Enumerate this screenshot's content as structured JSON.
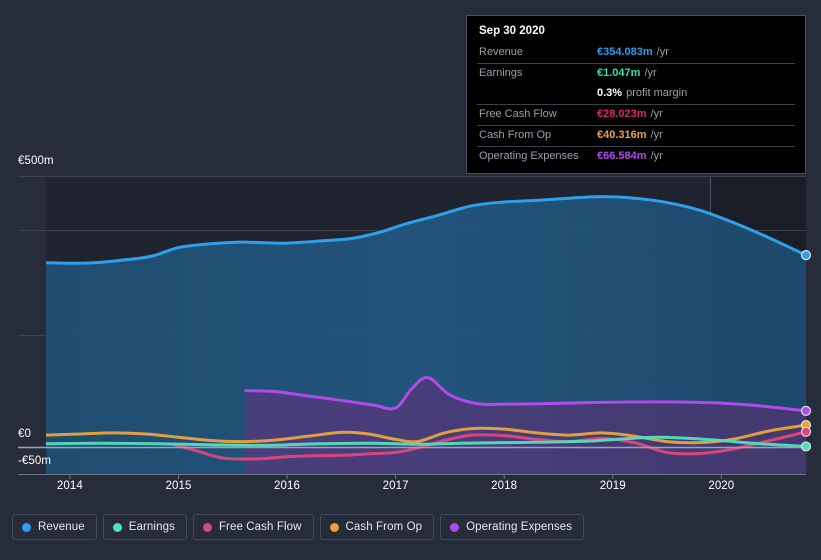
{
  "theme": {
    "background": "#262c3a",
    "plot_background": "#1f2430",
    "gridline": "#3a4050",
    "axis_line": "#8f96a3",
    "text": "#ffffff",
    "muted_text": "#9aa0ac"
  },
  "tooltip": {
    "date": "Sep 30 2020",
    "rows": [
      {
        "label": "Revenue",
        "value": "€354.083m",
        "unit": "/yr",
        "color": "#2e9fe8"
      },
      {
        "label": "Earnings",
        "value": "€1.047m",
        "unit": "/yr",
        "color": "#2ee0b0"
      },
      {
        "label": "Free Cash Flow",
        "value": "€28.023m",
        "unit": "/yr",
        "color": "#e0246e"
      },
      {
        "label": "Cash From Op",
        "value": "€40.316m",
        "unit": "/yr",
        "color": "#e8a33d"
      },
      {
        "label": "Operating Expenses",
        "value": "€66.584m",
        "unit": "/yr",
        "color": "#b14ae8"
      }
    ],
    "margin_value": "0.3%",
    "margin_label": "profit margin"
  },
  "legend": {
    "items": [
      {
        "label": "Revenue",
        "color": "#2e9fe8"
      },
      {
        "label": "Earnings",
        "color": "#52dfc0"
      },
      {
        "label": "Free Cash Flow",
        "color": "#e0467e"
      },
      {
        "label": "Cash From Op",
        "color": "#e8a33d"
      },
      {
        "label": "Operating Expenses",
        "color": "#b14ae8"
      }
    ]
  },
  "chart_data": {
    "type": "area",
    "title": "",
    "xlabel": "",
    "ylabel": "",
    "currency": "EUR",
    "units": "millions",
    "grid": true,
    "legend_position": "bottom",
    "y_ticks": [
      {
        "label": "€500m",
        "value": 500
      },
      {
        "label": "€0",
        "value": 0
      },
      {
        "label": "-€50m",
        "value": -50
      }
    ],
    "ylim": [
      -50,
      540
    ],
    "x_ticks": [
      "2014",
      "2015",
      "2016",
      "2017",
      "2018",
      "2019",
      "2020"
    ],
    "xlim": [
      2013.78,
      2020.78
    ],
    "highlight_region": {
      "from": 2019.9,
      "to": 2020.78
    },
    "series": [
      {
        "name": "Revenue",
        "color": "#2e9fe8",
        "fill": "#2a5d86",
        "x": [
          2013.78,
          2014.1,
          2014.4,
          2014.75,
          2015.0,
          2015.3,
          2015.6,
          2015.95,
          2016.3,
          2016.6,
          2016.85,
          2017.1,
          2017.4,
          2017.7,
          2018.0,
          2018.3,
          2018.6,
          2018.9,
          2019.2,
          2019.5,
          2019.8,
          2020.1,
          2020.45,
          2020.78
        ],
        "y": [
          340,
          339,
          343,
          352,
          368,
          375,
          378,
          376,
          380,
          385,
          396,
          412,
          428,
          445,
          452,
          455,
          459,
          462,
          459,
          451,
          437,
          415,
          385,
          354
        ]
      },
      {
        "name": "Operating Expenses",
        "color": "#b14ae8",
        "fill": "#4a3a77",
        "x": [
          2015.62,
          2015.9,
          2016.2,
          2016.5,
          2016.8,
          2017.0,
          2017.15,
          2017.3,
          2017.5,
          2017.75,
          2018.0,
          2018.4,
          2018.8,
          2019.2,
          2019.6,
          2020.0,
          2020.4,
          2020.78
        ],
        "y": [
          104,
          102,
          94,
          86,
          77,
          72,
          108,
          128,
          96,
          80,
          79,
          80,
          82,
          83,
          83,
          81,
          75,
          66.584
        ]
      },
      {
        "name": "Cash From Op",
        "color": "#e8a33d",
        "x": [
          2013.78,
          2014.1,
          2014.4,
          2014.7,
          2015.0,
          2015.3,
          2015.6,
          2015.9,
          2016.2,
          2016.5,
          2016.75,
          2017.0,
          2017.2,
          2017.45,
          2017.7,
          2018.0,
          2018.3,
          2018.6,
          2018.9,
          2019.2,
          2019.5,
          2019.8,
          2020.1,
          2020.45,
          2020.78
        ],
        "y": [
          22,
          24,
          26,
          24,
          18,
          12,
          10,
          13,
          20,
          27,
          24,
          14,
          10,
          26,
          34,
          33,
          26,
          22,
          26,
          20,
          10,
          8,
          14,
          30,
          40.316
        ]
      },
      {
        "name": "Free Cash Flow",
        "color": "#e0467e",
        "x": [
          2014.95,
          2015.15,
          2015.4,
          2015.7,
          2016.0,
          2016.3,
          2016.55,
          2016.8,
          2017.0,
          2017.2,
          2017.45,
          2017.7,
          2018.0,
          2018.3,
          2018.6,
          2018.9,
          2019.2,
          2019.5,
          2019.8,
          2020.1,
          2020.45,
          2020.78
        ],
        "y": [
          5,
          -6,
          -20,
          -22,
          -18,
          -16,
          -15,
          -12,
          -10,
          -2,
          12,
          22,
          21,
          14,
          10,
          16,
          8,
          -10,
          -12,
          -4,
          12,
          28.023
        ]
      },
      {
        "name": "Earnings",
        "color": "#52dfc0",
        "x": [
          2013.78,
          2014.3,
          2014.8,
          2015.3,
          2015.8,
          2016.3,
          2016.8,
          2017.2,
          2017.6,
          2018.0,
          2018.4,
          2018.8,
          2019.1,
          2019.4,
          2019.7,
          2020.0,
          2020.35,
          2020.78
        ],
        "y": [
          6,
          7,
          6,
          4,
          3,
          6,
          7,
          5,
          7,
          8,
          9,
          11,
          15,
          18,
          16,
          12,
          6,
          1.047
        ]
      }
    ]
  }
}
